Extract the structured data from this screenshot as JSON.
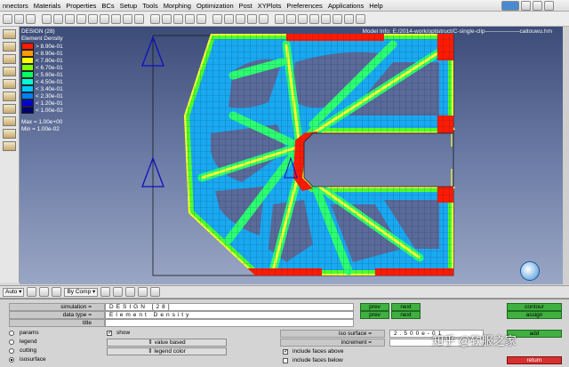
{
  "menu": [
    "nnectors",
    "Materials",
    "Properties",
    "BCs",
    "Setup",
    "Tools",
    "Morphing",
    "Optimization",
    "Post",
    "XYPlots",
    "Preferences",
    "Applications",
    "Help"
  ],
  "legend": {
    "title1": "DESIGN (28)",
    "title2": "Element Density",
    "entries": [
      {
        "label": "> 8.90e-01",
        "color": "#ff1a00"
      },
      {
        "label": "< 8.90e-01",
        "color": "#ff9a00"
      },
      {
        "label": "< 7.80e-01",
        "color": "#ffff00"
      },
      {
        "label": "< 6.70e-01",
        "color": "#7fff00"
      },
      {
        "label": "< 5.60e-01",
        "color": "#00ff60"
      },
      {
        "label": "< 4.50e-01",
        "color": "#00ffd0"
      },
      {
        "label": "< 3.40e-01",
        "color": "#00c8ff"
      },
      {
        "label": "< 2.30e-01",
        "color": "#0080ff"
      },
      {
        "label": "< 1.20e-01",
        "color": "#0000d8"
      },
      {
        "label": "< 1.00e-02",
        "color": "#000070"
      }
    ],
    "max": "Max = 1.00e+00",
    "min": "Min = 1.00e-02"
  },
  "model_info": "Model Info: E:/2014-work/optistruct/C-single-clip——————caitouwu.hm",
  "ctrlbar": {
    "auto": "Auto",
    "by_comp": "By Comp"
  },
  "panel": {
    "simulation_label": "simulation =",
    "data_type_label": "data type =",
    "title_label": "title",
    "simulation_value": "DESIGN [28]",
    "data_type_value": "Element Density",
    "prev": "prev",
    "next": "next",
    "contour": "contour",
    "assign": "assign",
    "radios": [
      "params",
      "legend",
      "cutting",
      "isosurface"
    ],
    "show": "show",
    "value_based": "value based",
    "legend_color": "legend color",
    "iso_surface": "iso surface =",
    "iso_value": "2.500e-01",
    "increment": "increment =",
    "faces_above": "include faces above",
    "faces_below": "include faces below",
    "add": "add",
    "return": "return"
  },
  "watermark": "知乎 @软服之家"
}
